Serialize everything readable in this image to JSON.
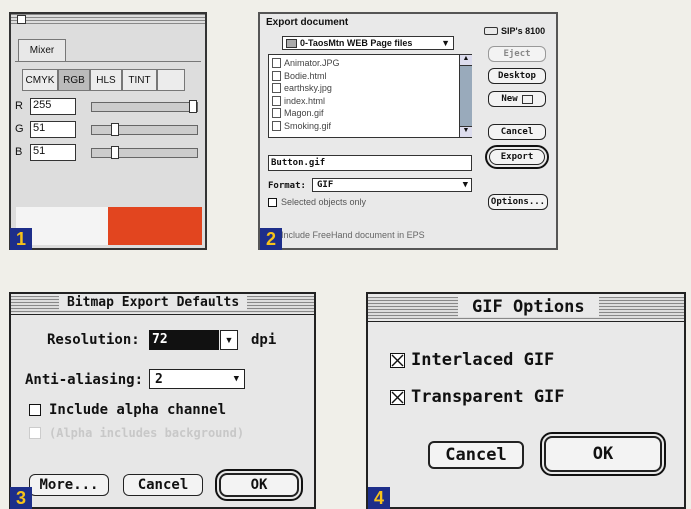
{
  "panel1": {
    "badge": "1",
    "tab_label": "Mixer",
    "modes": [
      "CMYK",
      "RGB",
      "HLS",
      "TINT"
    ],
    "apple_glyph": "",
    "r_label": "R",
    "r_value": "255",
    "r_level": 1.0,
    "g_label": "G",
    "g_value": "51",
    "g_level": 0.2,
    "b_label": "B",
    "b_value": "51",
    "b_level": 0.2,
    "color_swatch": "#e2451f"
  },
  "panel2": {
    "badge": "2",
    "title": "Export document",
    "folder": "0-TaosMtn WEB Page files",
    "disk": "SIP's 8100",
    "files": [
      "Animator.JPG",
      "Bodie.html",
      "earthsky.jpg",
      "index.html",
      "Magon.gif",
      "Smoking.gif"
    ],
    "eject": "Eject",
    "desktop": "Desktop",
    "new": "New",
    "cancel": "Cancel",
    "export": "Export",
    "filename": "Button.gif",
    "format_label": "Format:",
    "format_value": "GIF",
    "selected_only": "Selected objects only",
    "options": "Options...",
    "include_doc": "Include FreeHand document in EPS"
  },
  "panel3": {
    "badge": "3",
    "title": "Bitmap Export Defaults",
    "resolution_label": "Resolution:",
    "resolution_value": "72",
    "dpi": "dpi",
    "aa_label": "Anti-aliasing:",
    "aa_value": "2",
    "alpha": "Include alpha channel",
    "alpha_sub": "(Alpha includes background)",
    "more": "More...",
    "cancel": "Cancel",
    "ok": "OK"
  },
  "panel4": {
    "badge": "4",
    "title": "GIF Options",
    "interlaced": "Interlaced GIF",
    "transparent": "Transparent GIF",
    "cancel": "Cancel",
    "ok": "OK"
  }
}
